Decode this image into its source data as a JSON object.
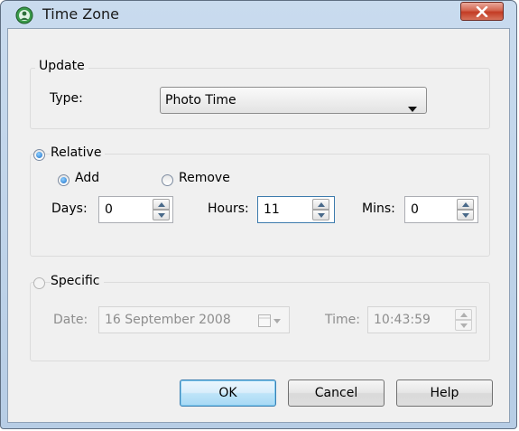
{
  "window": {
    "title": "Time Zone"
  },
  "update_group": {
    "legend": "Update",
    "type_label": "Type:",
    "type_value": "Photo Time"
  },
  "relative_group": {
    "legend": "Relative",
    "selected": true,
    "add_label": "Add",
    "add_selected": true,
    "remove_label": "Remove",
    "remove_selected": false,
    "days_label": "Days:",
    "days_value": "0",
    "hours_label": "Hours:",
    "hours_value": "11",
    "mins_label": "Mins:",
    "mins_value": "0"
  },
  "specific_group": {
    "legend": "Specific",
    "selected": false,
    "date_label": "Date:",
    "date_value": "16 September 2008",
    "time_label": "Time:",
    "time_value": "10:43:59"
  },
  "buttons": {
    "ok": "OK",
    "cancel": "Cancel",
    "help": "Help"
  },
  "colors": {
    "title_bar": "#c9dbee",
    "close_button": "#c33b24",
    "focus_border": "#3d7bad"
  }
}
